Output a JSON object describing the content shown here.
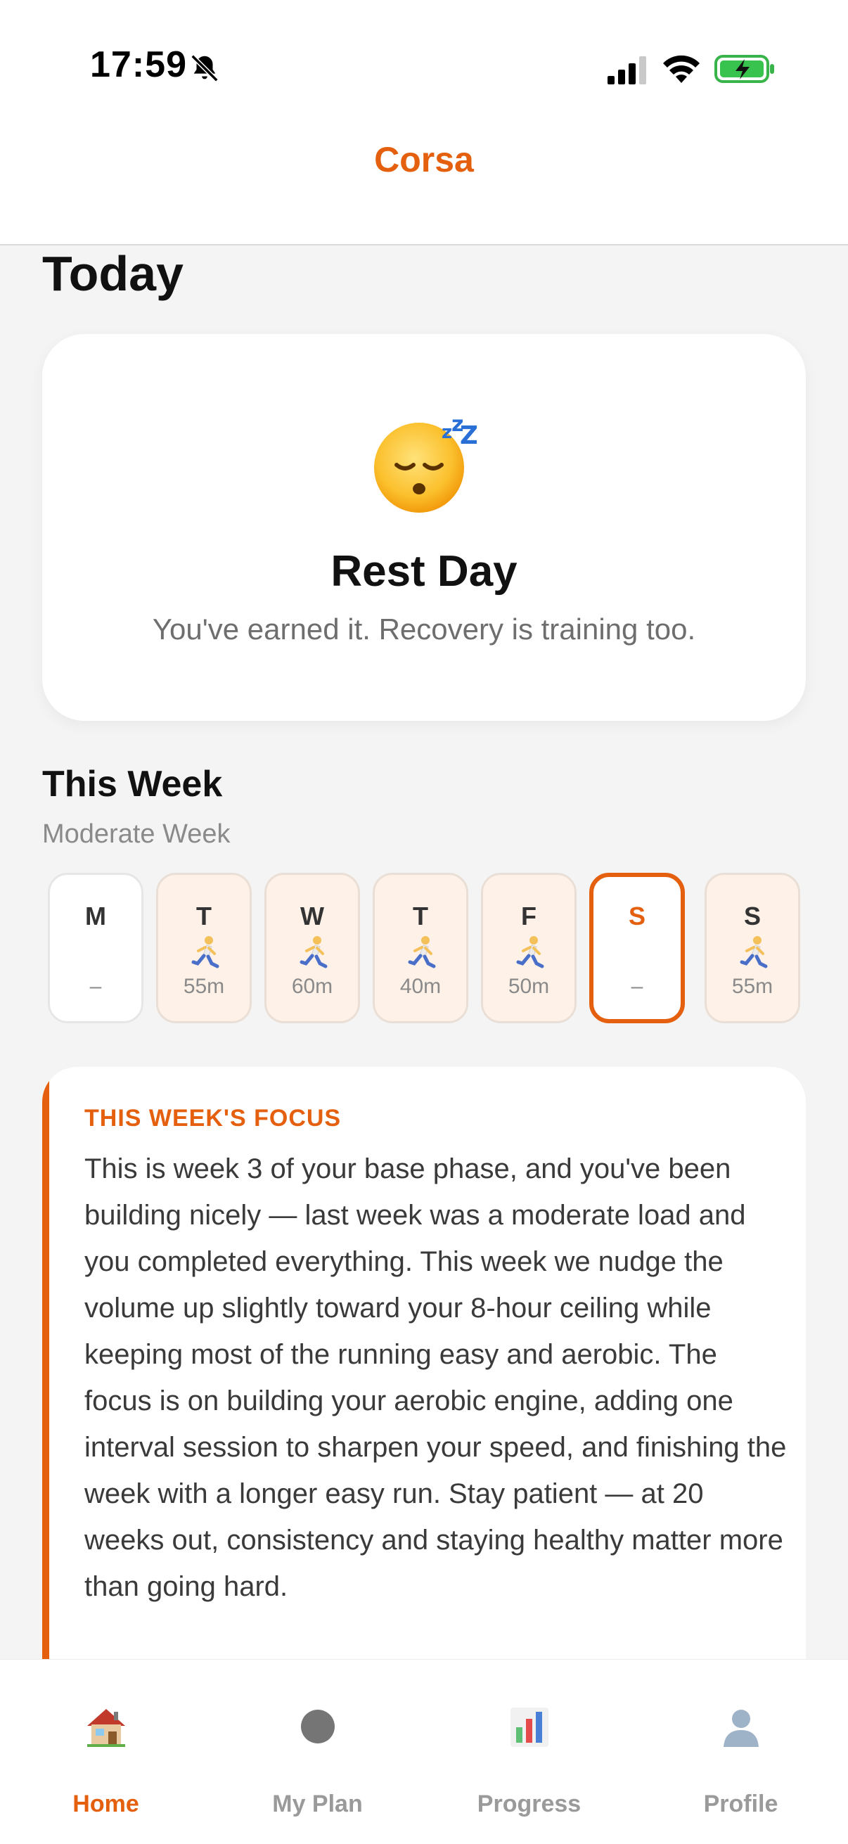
{
  "status_bar": {
    "time": "17:59",
    "icons": [
      "bell-slash-icon",
      "signal-icon",
      "wifi-icon",
      "battery-charging-icon"
    ]
  },
  "header": {
    "title": "Corsa"
  },
  "today": {
    "title": "Today",
    "card": {
      "icon": "sleeping-face-icon",
      "title": "Rest Day",
      "subtitle": "You've earned it. Recovery is training too."
    }
  },
  "week": {
    "title": "This Week",
    "subtitle": "Moderate Week",
    "days": [
      {
        "letter": "M",
        "duration": "–",
        "has_run": false,
        "active": false
      },
      {
        "letter": "T",
        "duration": "55m",
        "has_run": true,
        "active": false
      },
      {
        "letter": "W",
        "duration": "60m",
        "has_run": true,
        "active": false
      },
      {
        "letter": "T",
        "duration": "40m",
        "has_run": true,
        "active": false
      },
      {
        "letter": "F",
        "duration": "50m",
        "has_run": true,
        "active": false
      },
      {
        "letter": "S",
        "duration": "–",
        "has_run": false,
        "active": true
      },
      {
        "letter": "S",
        "duration": "55m",
        "has_run": true,
        "active": false
      }
    ]
  },
  "focus": {
    "label": "THIS WEEK'S FOCUS",
    "text": "This is week 3 of your base phase, and you've been building nicely — last week was a moderate load and you completed everything. This week we nudge the volume up slightly toward your 8-hour ceiling while keeping most of the running easy and aerobic. The focus is on building your aerobic engine, adding one interval session to sharpen your speed, and finishing the week with a longer easy run. Stay patient — at 20 weeks out, consistency and staying healthy matter more than going hard."
  },
  "tabs": [
    {
      "label": "Home",
      "icon": "house-icon",
      "active": true
    },
    {
      "label": "My Plan",
      "icon": "circle-icon",
      "active": false
    },
    {
      "label": "Progress",
      "icon": "bar-chart-icon",
      "active": false
    },
    {
      "label": "Profile",
      "icon": "person-silhouette-icon",
      "active": false
    }
  ],
  "colors": {
    "accent": "#e4600e",
    "background": "#f4f4f4",
    "card": "#ffffff",
    "day_plan_bg": "#fdf1e8"
  }
}
